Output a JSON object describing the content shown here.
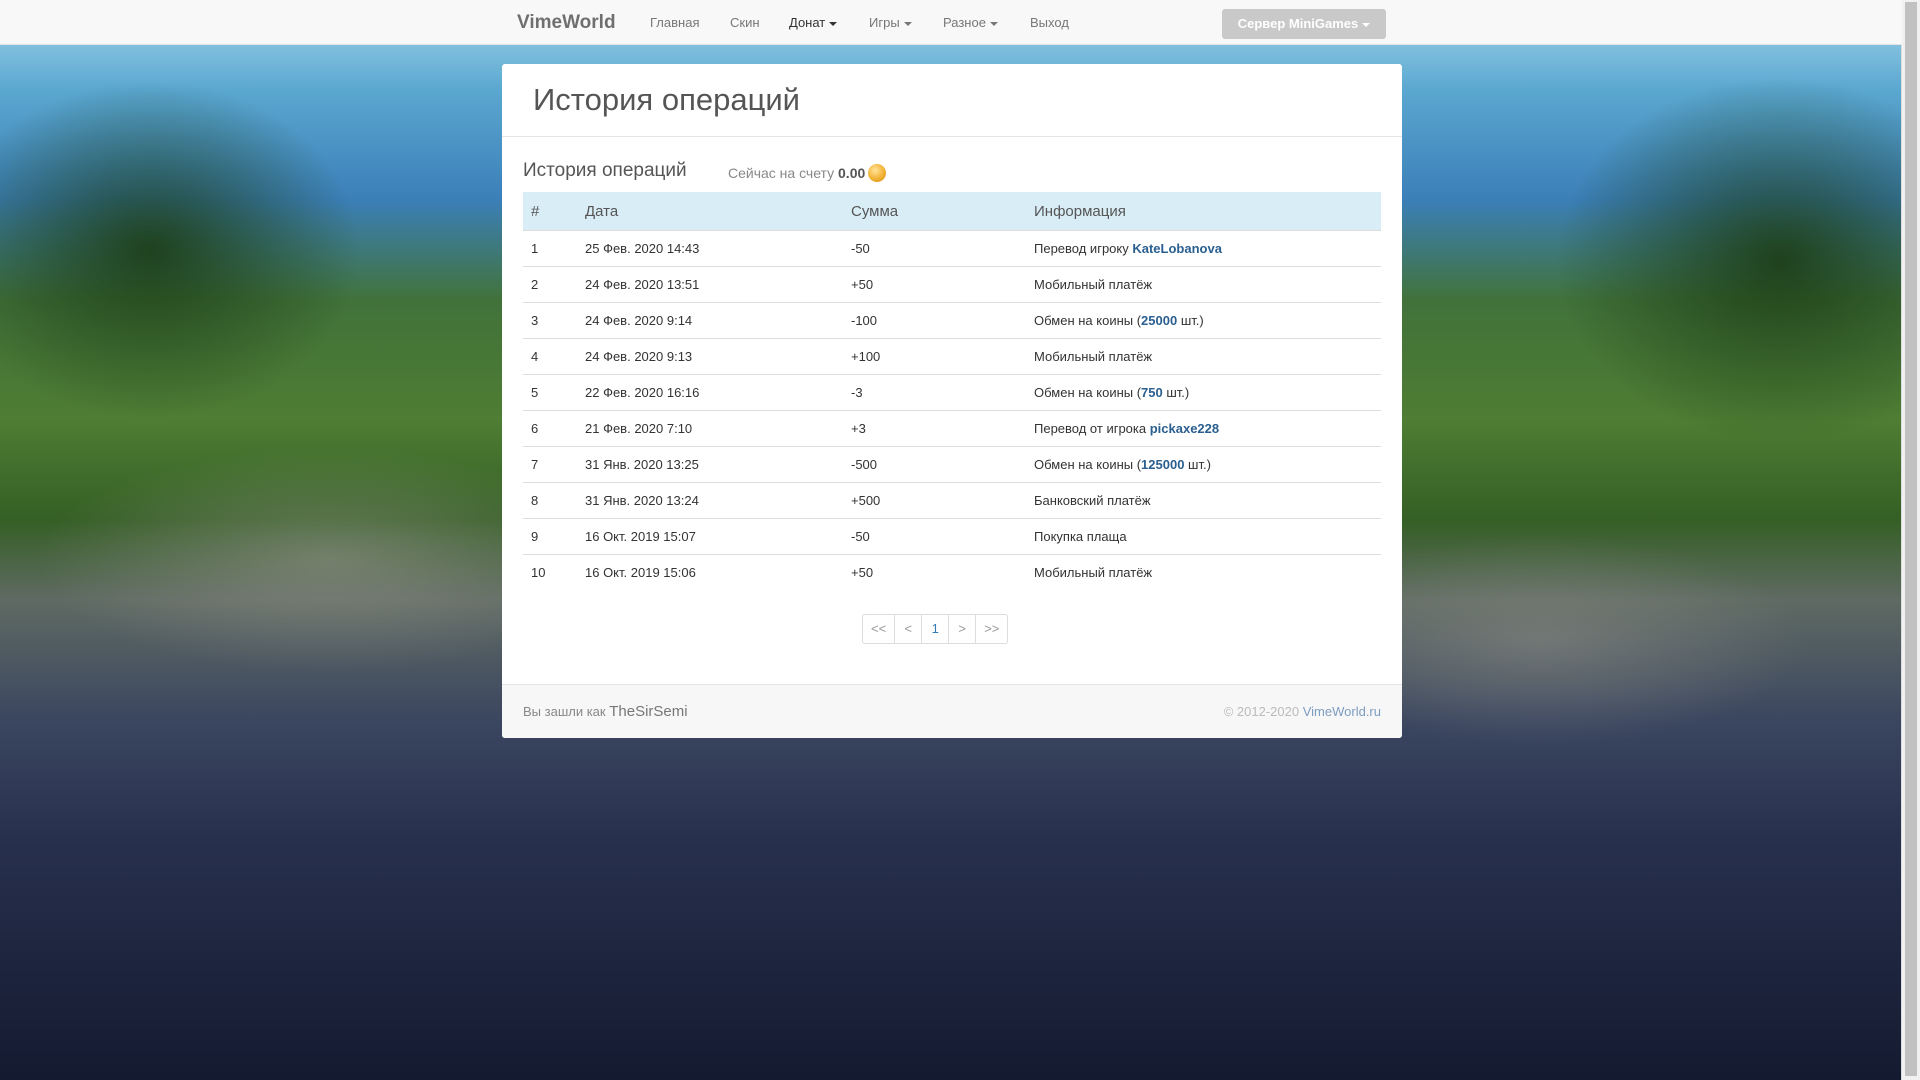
{
  "navbar": {
    "brand": "VimeWorld",
    "items": [
      {
        "label": "Главная"
      },
      {
        "label": "Скин"
      },
      {
        "label": "Донат"
      },
      {
        "label": "Игры"
      },
      {
        "label": "Разное"
      },
      {
        "label": "Выход"
      }
    ],
    "server_button": "Сервер MiniGames"
  },
  "page": {
    "title": "История операций",
    "subheading": "История операций",
    "balance_label": "Сейчас на счету",
    "balance_value": "0.00"
  },
  "table": {
    "headers": [
      "#",
      "Дата",
      "Сумма",
      "Информация"
    ],
    "rows": [
      {
        "n": "1",
        "date": "25 Фев. 2020 14:43",
        "sum": "-50",
        "info_pre": "Перевод игроку ",
        "info_link": "KateLobanova",
        "info_post": ""
      },
      {
        "n": "2",
        "date": "24 Фев. 2020 13:51",
        "sum": "+50",
        "info_pre": "Мобильный платёж",
        "info_link": "",
        "info_post": ""
      },
      {
        "n": "3",
        "date": "24 Фев. 2020 9:14",
        "sum": "-100",
        "info_pre": "Обмен на коины (",
        "info_link": "25000",
        "info_post": " шт.)"
      },
      {
        "n": "4",
        "date": "24 Фев. 2020 9:13",
        "sum": "+100",
        "info_pre": "Мобильный платёж",
        "info_link": "",
        "info_post": ""
      },
      {
        "n": "5",
        "date": "22 Фев. 2020 16:16",
        "sum": "-3",
        "info_pre": "Обмен на коины (",
        "info_link": "750",
        "info_post": " шт.)"
      },
      {
        "n": "6",
        "date": "21 Фев. 2020 7:10",
        "sum": "+3",
        "info_pre": "Перевод от игрока ",
        "info_link": "pickaxe228",
        "info_post": ""
      },
      {
        "n": "7",
        "date": "31 Янв. 2020 13:25",
        "sum": "-500",
        "info_pre": "Обмен на коины (",
        "info_link": "125000",
        "info_post": " шт.)"
      },
      {
        "n": "8",
        "date": "31 Янв. 2020 13:24",
        "sum": "+500",
        "info_pre": "Банковский платёж",
        "info_link": "",
        "info_post": ""
      },
      {
        "n": "9",
        "date": "16 Окт. 2019 15:07",
        "sum": "-50",
        "info_pre": "Покупка плаща",
        "info_link": "",
        "info_post": ""
      },
      {
        "n": "10",
        "date": "16 Окт. 2019 15:06",
        "sum": "+50",
        "info_pre": "Мобильный платёж",
        "info_link": "",
        "info_post": ""
      }
    ]
  },
  "pagination": [
    "<<",
    "<",
    "1",
    ">",
    ">>"
  ],
  "footer": {
    "logged_in_label": "Вы зашли как",
    "username": "TheSirSemi",
    "copyright": "© 2012-2020",
    "site": "VimeWorld.ru"
  },
  "colors": {
    "negative": "#a94442",
    "positive": "#3c763d",
    "table_header": "#d9edf7"
  }
}
